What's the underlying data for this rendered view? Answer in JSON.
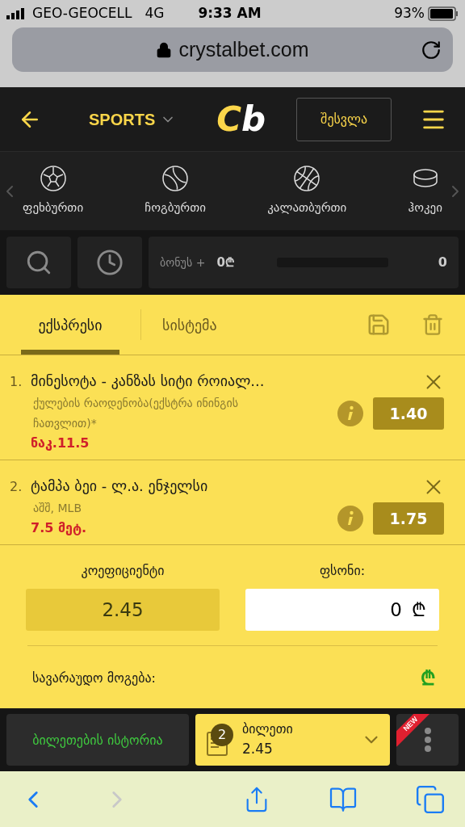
{
  "status_bar": {
    "carrier": "GEO-GEOCELL",
    "network": "4G",
    "time": "9:33 AM",
    "battery": "93%"
  },
  "browser": {
    "url": "crystalbet.com"
  },
  "header": {
    "menu_label": "SPORTS",
    "logo": [
      "C",
      "b"
    ],
    "login_button": "შესვლა"
  },
  "sports": [
    {
      "kind": "football",
      "label": "ფეხბურთი"
    },
    {
      "kind": "tennis",
      "label": "ჩოგბურთი"
    },
    {
      "kind": "basketball",
      "label": "კალათბურთი"
    },
    {
      "kind": "hockey",
      "label": "ჰოკეი"
    }
  ],
  "bonus": {
    "label": "ბონუს +",
    "amount": "0₾",
    "level": 0,
    "count": "0"
  },
  "tabs": [
    {
      "label": "ექსპრესი",
      "selected": true
    },
    {
      "label": "სისტემა",
      "selected": false
    }
  ],
  "bets": [
    {
      "number": "1.",
      "title": "მინესოტა - კანზას სიტი როიალ...",
      "market": "ქულების რაოდენობა(ექსტრა ინინგის ჩათვლით)*",
      "selection": "ნაკ.11.5",
      "odds": "1.40"
    },
    {
      "number": "2.",
      "title": "ტამპა ბეი - ლ.ა. ენჯელსი",
      "market": "აშშ, MLB",
      "selection": "7.5 მეტ.",
      "odds": "1.75"
    }
  ],
  "totals": {
    "coef_label": "კოეფიციენტი",
    "coef_value": "2.45",
    "stake_label": "ფსონი:",
    "stake_value": "0",
    "stake_currency": "₾",
    "win_label": "სავარაუდო მოგება:",
    "win_value": "₾"
  },
  "bottom_bar": {
    "history": "ბილეთების ისტორია",
    "ticket_count": "2",
    "ticket_label": "ბილეთი",
    "ticket_odds": "2.45",
    "new_badge": "NEW"
  }
}
